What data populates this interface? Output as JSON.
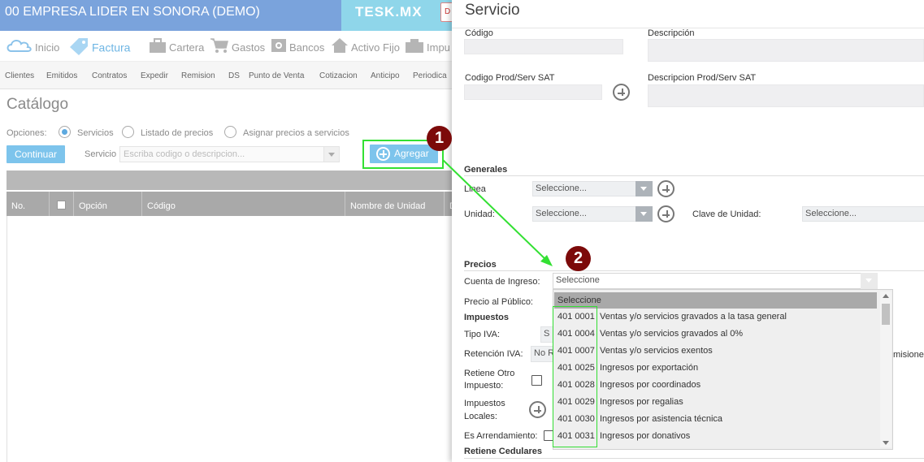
{
  "app": {
    "company": "00 EMPRESA LIDER EN SONORA (DEMO)",
    "brand": "TESK.MX",
    "brand_button": "D"
  },
  "modules": [
    {
      "label": "Inicio",
      "icon": "cloud-icon"
    },
    {
      "label": "Factura",
      "icon": "tag-icon"
    },
    {
      "label": "Cartera",
      "icon": "briefcase-icon"
    },
    {
      "label": "Gastos",
      "icon": "cart-icon"
    },
    {
      "label": "Bancos",
      "icon": "safe-icon"
    },
    {
      "label": "Activo Fijo",
      "icon": "house-icon"
    },
    {
      "label": "Impu",
      "icon": "stamp-icon"
    }
  ],
  "subnav": [
    "Clientes",
    "Emitidos",
    "Contratos",
    "Expedir",
    "Remision",
    "DS",
    "Punto de Venta",
    "Cotizacion",
    "Anticipo",
    "Periodica"
  ],
  "catalog": {
    "title": "Catálogo",
    "options_label": "Opciones:",
    "options": [
      "Servicios",
      "Listado de precios",
      "Asignar precios a servicios"
    ],
    "continue_button": "Continuar",
    "service_label": "Servicio",
    "service_placeholder": "Escriba codigo o descripcion...",
    "add_button": "Agregar",
    "columns": [
      "No.",
      "",
      "Opción",
      "Código",
      "Nombre de Unidad",
      "D"
    ]
  },
  "panel": {
    "title": "Servicio",
    "codigo_label": "Código",
    "descripcion_label": "Descripción",
    "codigo_sat_label": "Codigo Prod/Serv SAT",
    "descripcion_sat_label": "Descripcion Prod/Serv SAT",
    "generales_title": "Generales",
    "linea_label": "Linea",
    "linea_value": "Seleccione...",
    "unidad_label": "Unidad:",
    "unidad_value": "Seleccione...",
    "clave_unidad_label": "Clave de Unidad:",
    "clave_unidad_value": "Seleccione...",
    "precios_title": "Precios",
    "cuenta_ingreso_label": "Cuenta de Ingreso:",
    "cuenta_ingreso_value": "Seleccione",
    "precio_publico_label": "Precio al Público:",
    "impuestos_title": "Impuestos",
    "tipo_iva_label": "Tipo IVA:",
    "tipo_iva_value": "S",
    "retencion_iva_label": "Retención IVA:",
    "retencion_iva_value": "No R",
    "retiene_otro_label_1": "Retiene Otro",
    "retiene_otro_label_2": "Impuesto:",
    "impuestos_locales_label_1": "Impuestos",
    "impuestos_locales_label_2": "Locales:",
    "arrendamiento_label": "Es Arrendamiento:",
    "retiene_cedulares_title": "Retiene Cedulares",
    "right_cut_text": "misiones"
  },
  "dropdown": {
    "selected": "Seleccione",
    "options": [
      {
        "code": "401 0001",
        "desc": "Ventas y/o servicios gravados a la tasa general"
      },
      {
        "code": "401 0004",
        "desc": "Ventas y/o servicios gravados al 0%"
      },
      {
        "code": "401 0007",
        "desc": "Ventas y/o servicios exentos"
      },
      {
        "code": "401 0025",
        "desc": "Ingresos por exportación"
      },
      {
        "code": "401 0028",
        "desc": "Ingresos por coordinados"
      },
      {
        "code": "401 0029",
        "desc": "Ingresos por regalias"
      },
      {
        "code": "401 0030",
        "desc": "Ingresos por asistencia técnica"
      },
      {
        "code": "401 0031",
        "desc": "Ingresos por donativos"
      }
    ]
  },
  "annotations": {
    "step1": "1",
    "step2": "2",
    "highlight_color": "#33e033",
    "badge_color": "#7c0a0a"
  }
}
